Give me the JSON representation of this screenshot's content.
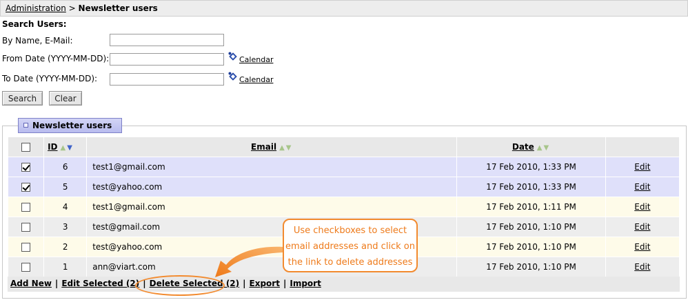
{
  "breadcrumb": {
    "parent": "Administration",
    "separator": ">",
    "current": "Newsletter users"
  },
  "search": {
    "title": "Search Users:",
    "name_label": "By Name, E-Mail:",
    "name_value": "",
    "from_label": "From Date (YYYY-MM-DD):",
    "from_value": "",
    "to_label": "To Date (YYYY-MM-DD):",
    "to_value": "",
    "calendar_label": "Calendar",
    "search_button": "Search",
    "clear_button": "Clear"
  },
  "panel": {
    "title": "Newsletter users"
  },
  "table": {
    "headers": {
      "id": "ID",
      "email": "Email",
      "date": "Date"
    },
    "rows": [
      {
        "checked": true,
        "id": "6",
        "email": "test1@gmail.com",
        "date": "17 Feb 2010, 1:33 PM",
        "action": "Edit",
        "style": "sel"
      },
      {
        "checked": true,
        "id": "5",
        "email": "test@yahoo.com",
        "date": "17 Feb 2010, 1:33 PM",
        "action": "Edit",
        "style": "sel"
      },
      {
        "checked": false,
        "id": "4",
        "email": "test1@gmail.com",
        "date": "17 Feb 2010, 1:11 PM",
        "action": "Edit",
        "style": "cream"
      },
      {
        "checked": false,
        "id": "3",
        "email": "test@gmail.com",
        "date": "17 Feb 2010, 1:10 PM",
        "action": "Edit",
        "style": "grey"
      },
      {
        "checked": false,
        "id": "2",
        "email": "test@yahoo.com",
        "date": "17 Feb 2010, 1:10 PM",
        "action": "Edit",
        "style": "cream"
      },
      {
        "checked": false,
        "id": "1",
        "email": "ann@viart.com",
        "date": "17 Feb 2010, 1:10 PM",
        "action": "Edit",
        "style": "grey"
      }
    ]
  },
  "footer": {
    "add_new": "Add New",
    "edit_selected": "Edit Selected (2)",
    "delete_selected": "Delete Selected (2)",
    "export": "Export",
    "import": "Import",
    "separator": "|"
  },
  "callout": {
    "line1": "Use checkboxes to select",
    "line2": "email addresses and click on",
    "line3": "the link to delete addresses"
  },
  "colors": {
    "accent_orange": "#f28a2e",
    "selected_row": "#dfe0fa",
    "tab_blue": "#b8bbee"
  }
}
